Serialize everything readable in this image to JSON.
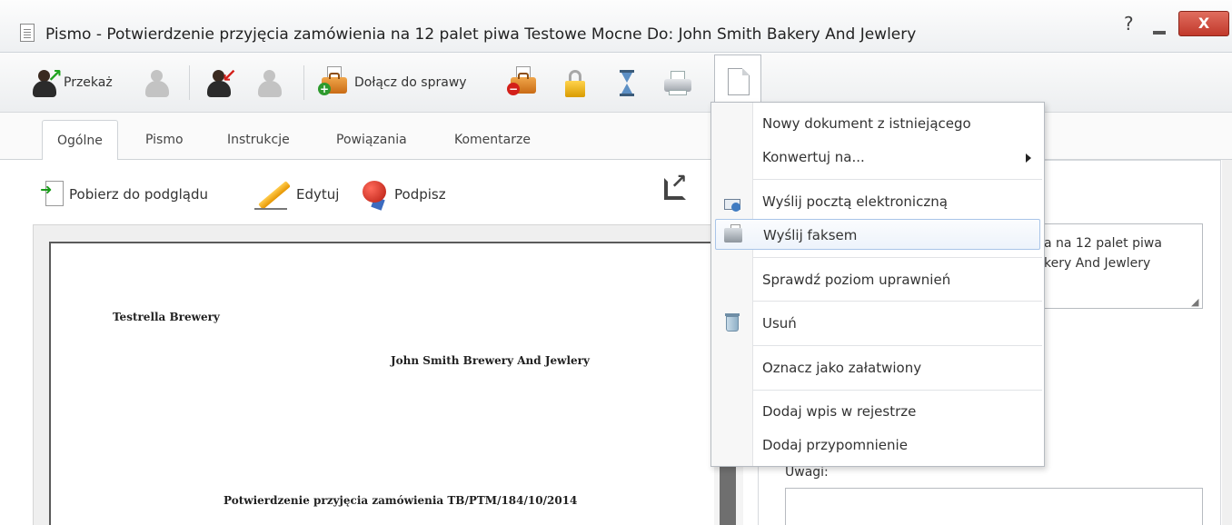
{
  "window": {
    "title": "Pismo - Potwierdzenie przyjęcia zamówienia na 12 palet piwa Testowe Mocne Do: John Smith Bakery And Jewlery",
    "help_glyph": "?",
    "close_glyph": "X"
  },
  "toolbar": {
    "forward_label": "Przekaż",
    "attach_label": "Dołącz do sprawy"
  },
  "tabs": [
    {
      "label": "Ogólne",
      "active": true
    },
    {
      "label": "Pismo"
    },
    {
      "label": "Instrukcje"
    },
    {
      "label": "Powiązania"
    },
    {
      "label": "Komentarze"
    }
  ],
  "actions": {
    "preview_label": "Pobierz do podglądu",
    "edit_label": "Edytuj",
    "sign_label": "Podpisz"
  },
  "document": {
    "sender": "Testrella Brewery",
    "recipient": "John Smith Brewery And Jewlery",
    "subject": "Potwierdzenie przyjęcia zamówienia TB/PTM/184/10/2014"
  },
  "details": {
    "title_line1": "a na 12 palet piwa",
    "title_line2": "kery And Jewlery",
    "notes_label": "Uwagi:"
  },
  "menu": {
    "items": [
      {
        "label": "Nowy dokument z istniejącego"
      },
      {
        "label": "Konwertuj na...",
        "submenu": true
      },
      {
        "label": "Wyślij pocztą elektroniczną",
        "icon": "mail-icon"
      },
      {
        "label": "Wyślij faksem",
        "icon": "fax-icon",
        "highlighted": true
      },
      {
        "label": "Sprawdź poziom uprawnień"
      },
      {
        "label": "Usuń",
        "icon": "trash-icon"
      },
      {
        "label": "Oznacz jako załatwiony"
      },
      {
        "label": "Dodaj wpis w rejestrze"
      },
      {
        "label": "Dodaj przypomnienie"
      }
    ]
  },
  "colors": {
    "close_button": "#c1392b",
    "menu_highlight_border": "#a9c5e8"
  }
}
